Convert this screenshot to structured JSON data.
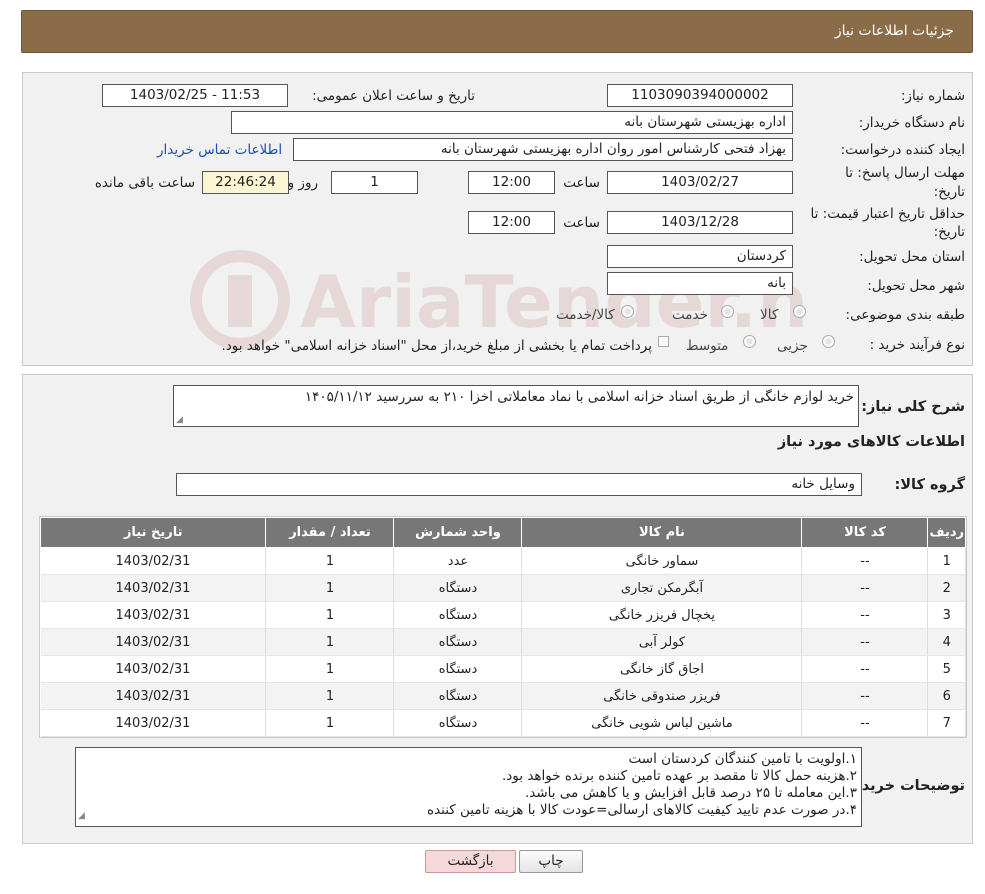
{
  "header": {
    "title": "جزئیات اطلاعات نیاز"
  },
  "form": {
    "need_number_label": "شماره نیاز:",
    "need_number": "1103090394000002",
    "announce_label": "تاریخ و ساعت اعلان عمومی:",
    "announce_value": "1403/02/25 - 11:53",
    "buyer_org_label": "نام دستگاه خریدار:",
    "buyer_org": "اداره بهزیستی شهرستان بانه",
    "creator_label": "ایجاد کننده درخواست:",
    "creator": "بهزاد فتحی کارشناس امور روان اداره بهزیستی شهرستان بانه",
    "contact_link": "اطلاعات تماس خریدار",
    "deadline_label_1": "مهلت ارسال پاسخ: تا",
    "deadline_label_2": "تاریخ:",
    "deadline_date": "1403/02/27",
    "time_label": "ساعت",
    "deadline_time": "12:00",
    "days_value": "1",
    "days_label": "روز و",
    "remaining_time": "22:46:24",
    "remaining_label": "ساعت باقی مانده",
    "validity_label_1": "حداقل تاریخ اعتبار قیمت: تا",
    "validity_label_2": "تاریخ:",
    "validity_date": "1403/12/28",
    "validity_time": "12:00",
    "province_label": "استان محل تحویل:",
    "province": "کردستان",
    "city_label": "شهر محل تحویل:",
    "city": "بانه",
    "category_label": "طبقه بندی موضوعی:",
    "category_options": [
      "کالا",
      "خدمت",
      "کالا/خدمت"
    ],
    "process_label": "نوع فرآیند خرید :",
    "process_options": [
      "جزیی",
      "متوسط"
    ],
    "process_note": "پرداخت تمام یا بخشی از مبلغ خرید،از محل \"اسناد خزانه اسلامی\" خواهد بود."
  },
  "description": {
    "label": "شرح کلی نیاز:",
    "text": "خرید لوازم خانگی  از طریق اسناد خزانه اسلامی با نماد معاملاتی اخزا ۲۱۰ به سررسید ۱۴۰۵/۱۱/۱۲"
  },
  "goods": {
    "section_title": "اطلاعات کالاهای مورد نیاز",
    "group_label": "گروه کالا:",
    "group_value": "وسایل خانه",
    "columns": [
      "ردیف",
      "کد کالا",
      "نام کالا",
      "واحد شمارش",
      "تعداد / مقدار",
      "تاریخ نیاز"
    ],
    "rows": [
      [
        "1",
        "--",
        "سماور خانگی",
        "عدد",
        "1",
        "1403/02/31"
      ],
      [
        "2",
        "--",
        "آبگرمکن تجاری",
        "دستگاه",
        "1",
        "1403/02/31"
      ],
      [
        "3",
        "--",
        "یخچال فریزر خانگی",
        "دستگاه",
        "1",
        "1403/02/31"
      ],
      [
        "4",
        "--",
        "کولر آبی",
        "دستگاه",
        "1",
        "1403/02/31"
      ],
      [
        "5",
        "--",
        "اجاق گاز خانگی",
        "دستگاه",
        "1",
        "1403/02/31"
      ],
      [
        "6",
        "--",
        "فریزر صندوقی خانگی",
        "دستگاه",
        "1",
        "1403/02/31"
      ],
      [
        "7",
        "--",
        "ماشین لباس شویی خانگی",
        "دستگاه",
        "1",
        "1403/02/31"
      ]
    ]
  },
  "buyer_notes": {
    "label": "توضیحات خریدار:",
    "lines": [
      "۱.اولویت با تامین کنندگان کردستان است",
      "۲.هزینه حمل کالا تا مقصد بر عهده تامین کننده برنده خواهد بود.",
      "۳.این معامله تا ۲۵ درصد قابل افزایش و یا کاهش می باشد.",
      "۴.در صورت عدم تایید کیفیت کالاهای ارسالی=عودت کالا با هزینه تامین کننده"
    ]
  },
  "buttons": {
    "print": "چاپ",
    "back": "بازگشت"
  },
  "watermark": {
    "text": "AriaTender.neT"
  },
  "colors": {
    "header_bg": "#8b6c48",
    "table_header_bg": "#777777",
    "link": "#1a4fb5",
    "back_button_bg": "#f7d8d8"
  }
}
